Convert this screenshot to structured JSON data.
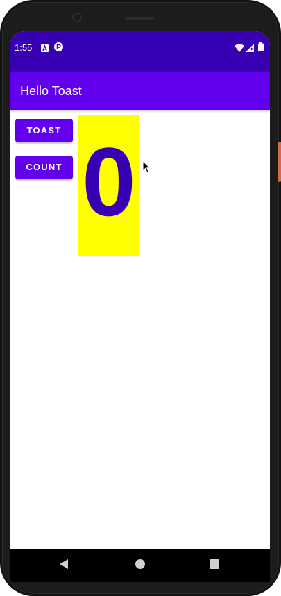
{
  "status_bar": {
    "time": "1:55",
    "color": "#3700b3",
    "left_icons": [
      "text-a-icon",
      "notification-p-icon"
    ],
    "right_icons": [
      "wifi-icon",
      "cell-signal-icon",
      "battery-icon"
    ]
  },
  "app_bar": {
    "title": "Hello Toast",
    "color": "#6200ee"
  },
  "main": {
    "toast_button_label": "TOAST",
    "count_button_label": "COUNT",
    "count_value": "0",
    "count_bg": "#ffff00",
    "count_color": "#3700b3"
  },
  "nav_bar": {
    "buttons": [
      "back-icon",
      "home-icon",
      "recents-icon"
    ]
  }
}
